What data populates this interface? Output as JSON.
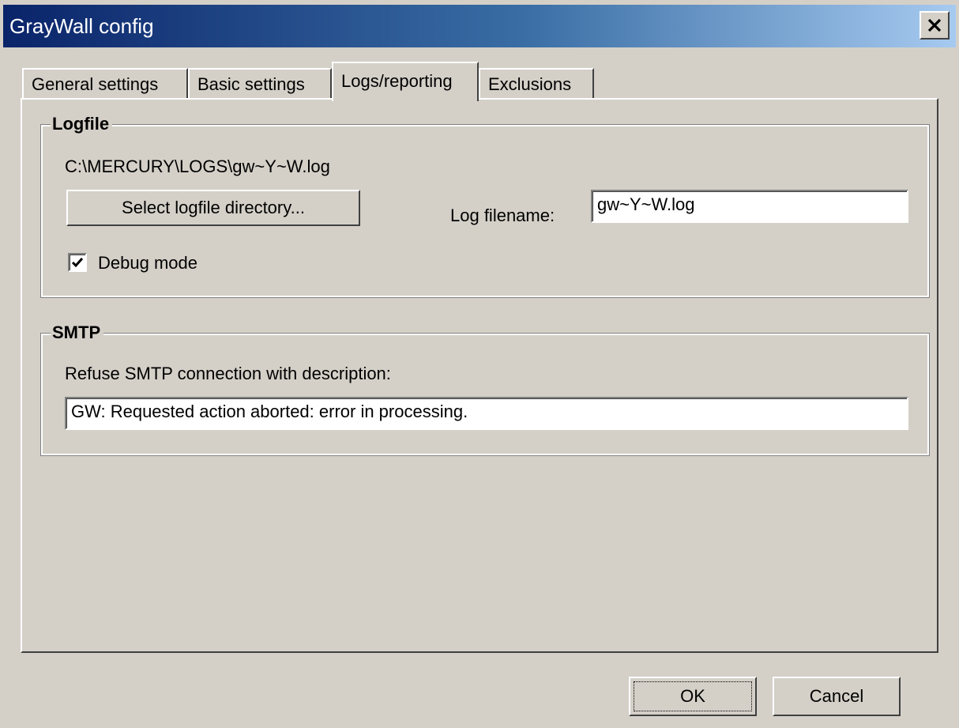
{
  "window": {
    "title": "GrayWall config"
  },
  "tabs": [
    {
      "label": "General settings"
    },
    {
      "label": "Basic settings"
    },
    {
      "label": "Logs/reporting"
    },
    {
      "label": "Exclusions"
    }
  ],
  "logfile": {
    "group_title": "Logfile",
    "path": "C:\\MERCURY\\LOGS\\gw~Y~W.log",
    "select_button_label": "Select logfile directory...",
    "filename_label": "Log filename:",
    "filename_value": "gw~Y~W.log",
    "debug_label": "Debug mode",
    "debug_checked": "true"
  },
  "smtp": {
    "group_title": "SMTP",
    "description_label": "Refuse SMTP connection with description:",
    "description_value": "GW: Requested action aborted: error in processing."
  },
  "buttons": {
    "ok_label": "OK",
    "cancel_label": "Cancel"
  },
  "colors": {
    "title_gradient_start": "#0a246a",
    "title_gradient_end": "#a6caf0",
    "face": "#d4d0c8"
  },
  "icons": {
    "close": "close-icon",
    "check": "checkmark-icon"
  }
}
